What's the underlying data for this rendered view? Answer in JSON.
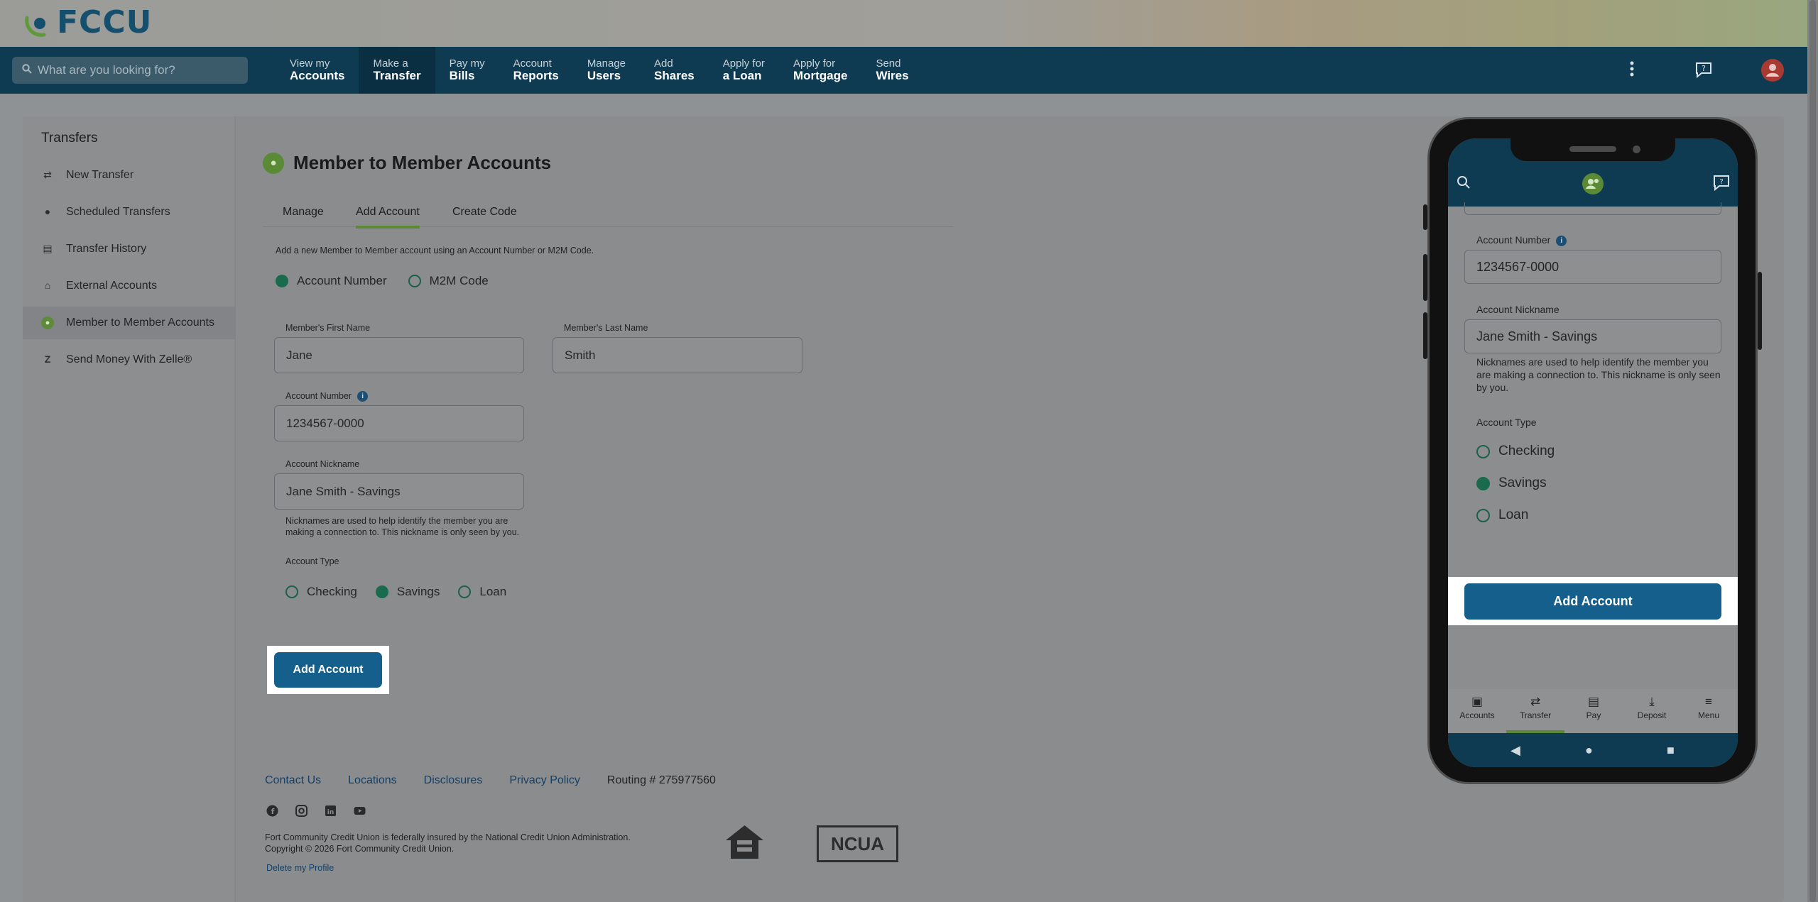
{
  "brand": {
    "name": "FCCU"
  },
  "search": {
    "placeholder": "What are you looking for?"
  },
  "nav": [
    {
      "top": "View my",
      "bottom": "Accounts"
    },
    {
      "top": "Make a",
      "bottom": "Transfer"
    },
    {
      "top": "Pay my",
      "bottom": "Bills"
    },
    {
      "top": "Account",
      "bottom": "Reports"
    },
    {
      "top": "Manage",
      "bottom": "Users"
    },
    {
      "top": "Add",
      "bottom": "Shares"
    },
    {
      "top": "Apply for",
      "bottom": "a Loan"
    },
    {
      "top": "Apply for",
      "bottom": "Mortgage"
    },
    {
      "top": "Send",
      "bottom": "Wires"
    }
  ],
  "sidebar": {
    "title": "Transfers",
    "items": [
      {
        "label": "New Transfer",
        "icon": "swap-arrows-icon"
      },
      {
        "label": "Scheduled Transfers",
        "icon": "clock-icon"
      },
      {
        "label": "Transfer History",
        "icon": "calendar-icon"
      },
      {
        "label": "External Accounts",
        "icon": "bank-icon"
      },
      {
        "label": "Member to Member Accounts",
        "icon": "members-icon"
      },
      {
        "label": "Send Money With Zelle®",
        "icon": "zelle-icon"
      }
    ]
  },
  "page": {
    "title": "Member to Member Accounts",
    "tabs": [
      "Manage",
      "Add Account",
      "Create Code"
    ],
    "intro": "Add a new Member to Member account using an Account Number or M2M Code.",
    "method_options": [
      "Account Number",
      "M2M Code"
    ],
    "first_name_label": "Member's First Name",
    "first_name_value": "Jane",
    "last_name_label": "Member's Last Name",
    "last_name_value": "Smith",
    "account_number_label": "Account Number",
    "account_number_value": "1234567-0000",
    "nickname_label": "Account Nickname",
    "nickname_value": "Jane Smith - Savings",
    "nickname_hint_1": "Nicknames are used to help identify the member you are",
    "nickname_hint_2": "making a connection to. This nickname is only seen by you.",
    "account_type_label": "Account Type",
    "account_types": [
      "Checking",
      "Savings",
      "Loan"
    ],
    "submit_label": "Add Account"
  },
  "footer": {
    "links": [
      "Contact Us",
      "Locations",
      "Disclosures",
      "Privacy Policy"
    ],
    "routing": "Routing # 275977560",
    "legal_1": "Fort Community Credit Union is federally insured by the National Credit Union Administration.",
    "legal_2": "Copyright © 2026 Fort Community Credit Union.",
    "delete_profile": "Delete my Profile",
    "ncua": "NCUA"
  },
  "mobile": {
    "account_number_label": "Account Number",
    "account_number_value": "1234567-0000",
    "nickname_label": "Account Nickname",
    "nickname_value": "Jane Smith - Savings",
    "hint": "Nicknames are used to help identify the member you are making a connection to. This nickname is only seen by you.",
    "account_type_label": "Account Type",
    "account_types": [
      "Checking",
      "Savings",
      "Loan"
    ],
    "submit_label": "Add Account",
    "tabs": [
      "Accounts",
      "Transfer",
      "Pay",
      "Deposit",
      "Menu"
    ]
  }
}
